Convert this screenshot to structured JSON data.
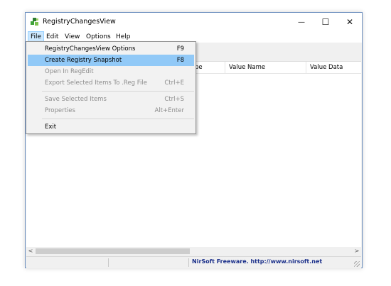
{
  "window": {
    "title": "RegistryChangesView",
    "minimize_glyph": "—",
    "maximize_glyph": "☐",
    "close_glyph": "✕"
  },
  "menubar": {
    "items": [
      "File",
      "Edit",
      "View",
      "Options",
      "Help"
    ],
    "active": "File"
  },
  "file_menu": {
    "items": [
      {
        "label": "RegistryChangesView Options",
        "shortcut": "F9",
        "state": "enabled"
      },
      {
        "label": "Create Registry Snapshot",
        "shortcut": "F8",
        "state": "highlighted"
      },
      {
        "label": "Open In RegEdit",
        "shortcut": "",
        "state": "disabled"
      },
      {
        "label": "Export Selected Items To .Reg File",
        "shortcut": "Ctrl+E",
        "state": "disabled"
      },
      {
        "label": "Save Selected Items",
        "shortcut": "Ctrl+S",
        "state": "disabled"
      },
      {
        "label": "Properties",
        "shortcut": "Alt+Enter",
        "state": "disabled"
      },
      {
        "label": "Exit",
        "shortcut": "",
        "state": "enabled"
      }
    ]
  },
  "list": {
    "columns": [
      "",
      "pe",
      "Value Name",
      "Value Data"
    ],
    "rows": []
  },
  "scrollbar": {
    "left_glyph": "<",
    "right_glyph": ">"
  },
  "statusbar": {
    "text": "NirSoft Freeware.  http://www.nirsoft.net"
  },
  "colors": {
    "highlight": "#91c9f7",
    "status_text": "#1a2f8a",
    "icon_green": "#3fa33a"
  },
  "icons": {
    "app": "registry-cubes-icon"
  }
}
